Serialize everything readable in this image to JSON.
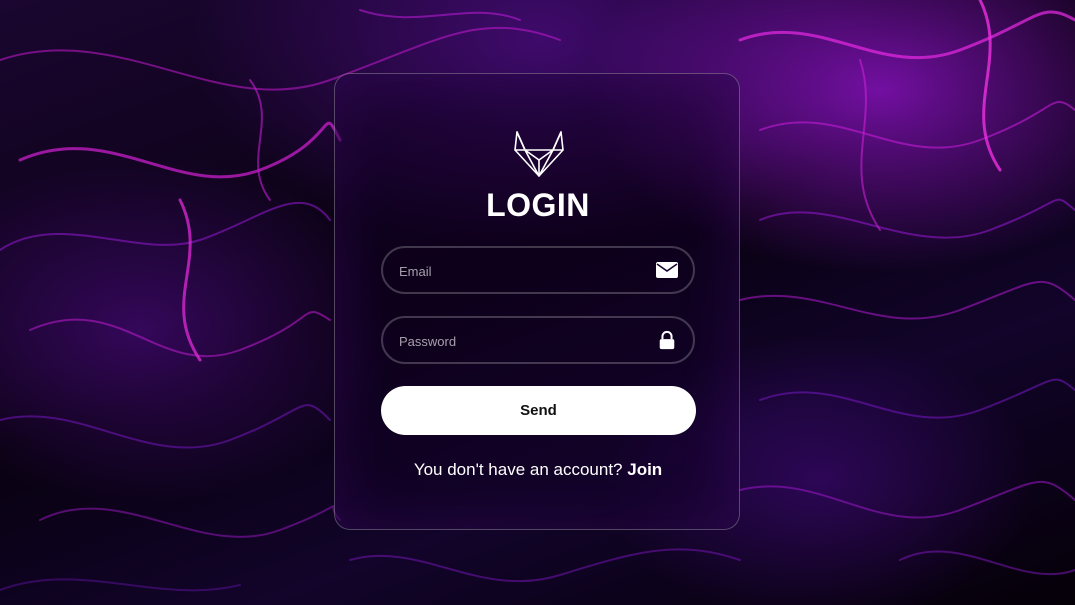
{
  "background": {
    "description_colors": {
      "base": "#050008",
      "accent_magenta": "#d21bd8",
      "accent_purple": "#7a12c4"
    }
  },
  "login": {
    "logo_icon": "fox-logo-icon",
    "title": "LOGIN",
    "email": {
      "placeholder": "Email",
      "value": "",
      "icon": "envelope-icon"
    },
    "password": {
      "placeholder": "Password",
      "value": "",
      "icon": "lock-icon"
    },
    "submit_label": "Send",
    "footer_text": "You don't have an account?",
    "join_link": "Join"
  }
}
